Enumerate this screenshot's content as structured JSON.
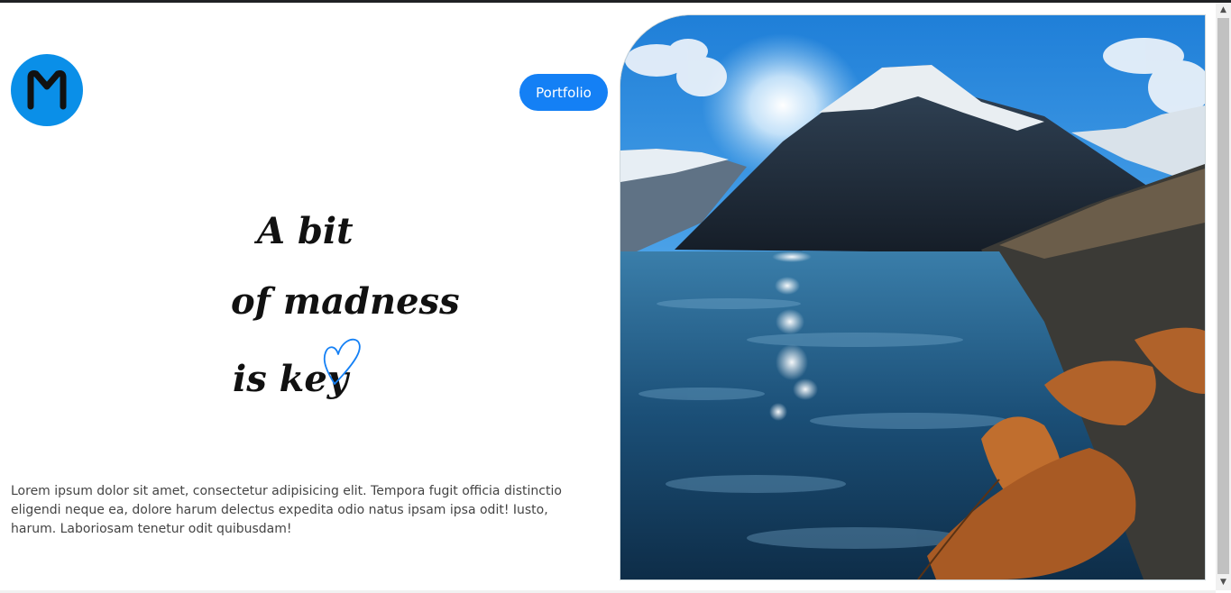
{
  "header": {
    "logo_icon": "m-logo-icon",
    "portfolio_label": "Portfolio"
  },
  "hero": {
    "line1": "A bit",
    "line2": "of madness",
    "line3": "is key",
    "heart_icon": "heart-outline-icon"
  },
  "body_text": "Lorem ipsum dolor sit amet, consectetur adipisicing elit. Tempora fugit officia distinctio eligendi neque ea, dolore harum delectus expedita odio natus ipsam ipsa odit! Iusto, harum. Laboriosam tenetur odit quibusdam!",
  "image": {
    "subject": "mountain-lake-landscape"
  },
  "colors": {
    "accent": "#1480f5",
    "logo_bg": "#0a8fe8",
    "text": "#111111"
  }
}
